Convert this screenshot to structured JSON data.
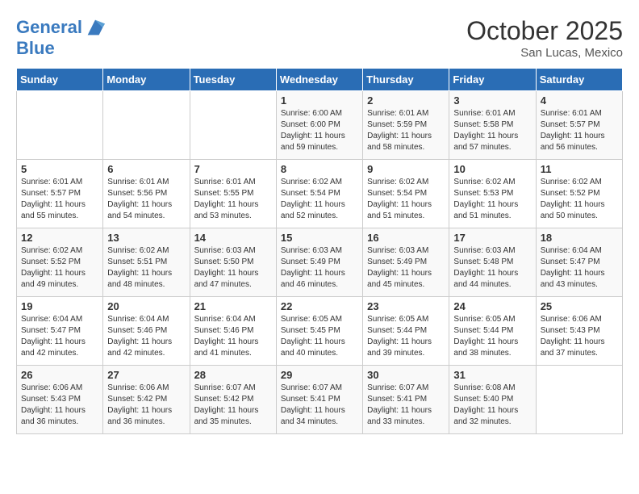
{
  "logo": {
    "line1": "General",
    "line2": "Blue"
  },
  "header": {
    "month": "October 2025",
    "location": "San Lucas, Mexico"
  },
  "days_of_week": [
    "Sunday",
    "Monday",
    "Tuesday",
    "Wednesday",
    "Thursday",
    "Friday",
    "Saturday"
  ],
  "weeks": [
    [
      {
        "day": "",
        "info": ""
      },
      {
        "day": "",
        "info": ""
      },
      {
        "day": "",
        "info": ""
      },
      {
        "day": "1",
        "info": "Sunrise: 6:00 AM\nSunset: 6:00 PM\nDaylight: 11 hours\nand 59 minutes."
      },
      {
        "day": "2",
        "info": "Sunrise: 6:01 AM\nSunset: 5:59 PM\nDaylight: 11 hours\nand 58 minutes."
      },
      {
        "day": "3",
        "info": "Sunrise: 6:01 AM\nSunset: 5:58 PM\nDaylight: 11 hours\nand 57 minutes."
      },
      {
        "day": "4",
        "info": "Sunrise: 6:01 AM\nSunset: 5:57 PM\nDaylight: 11 hours\nand 56 minutes."
      }
    ],
    [
      {
        "day": "5",
        "info": "Sunrise: 6:01 AM\nSunset: 5:57 PM\nDaylight: 11 hours\nand 55 minutes."
      },
      {
        "day": "6",
        "info": "Sunrise: 6:01 AM\nSunset: 5:56 PM\nDaylight: 11 hours\nand 54 minutes."
      },
      {
        "day": "7",
        "info": "Sunrise: 6:01 AM\nSunset: 5:55 PM\nDaylight: 11 hours\nand 53 minutes."
      },
      {
        "day": "8",
        "info": "Sunrise: 6:02 AM\nSunset: 5:54 PM\nDaylight: 11 hours\nand 52 minutes."
      },
      {
        "day": "9",
        "info": "Sunrise: 6:02 AM\nSunset: 5:54 PM\nDaylight: 11 hours\nand 51 minutes."
      },
      {
        "day": "10",
        "info": "Sunrise: 6:02 AM\nSunset: 5:53 PM\nDaylight: 11 hours\nand 51 minutes."
      },
      {
        "day": "11",
        "info": "Sunrise: 6:02 AM\nSunset: 5:52 PM\nDaylight: 11 hours\nand 50 minutes."
      }
    ],
    [
      {
        "day": "12",
        "info": "Sunrise: 6:02 AM\nSunset: 5:52 PM\nDaylight: 11 hours\nand 49 minutes."
      },
      {
        "day": "13",
        "info": "Sunrise: 6:02 AM\nSunset: 5:51 PM\nDaylight: 11 hours\nand 48 minutes."
      },
      {
        "day": "14",
        "info": "Sunrise: 6:03 AM\nSunset: 5:50 PM\nDaylight: 11 hours\nand 47 minutes."
      },
      {
        "day": "15",
        "info": "Sunrise: 6:03 AM\nSunset: 5:49 PM\nDaylight: 11 hours\nand 46 minutes."
      },
      {
        "day": "16",
        "info": "Sunrise: 6:03 AM\nSunset: 5:49 PM\nDaylight: 11 hours\nand 45 minutes."
      },
      {
        "day": "17",
        "info": "Sunrise: 6:03 AM\nSunset: 5:48 PM\nDaylight: 11 hours\nand 44 minutes."
      },
      {
        "day": "18",
        "info": "Sunrise: 6:04 AM\nSunset: 5:47 PM\nDaylight: 11 hours\nand 43 minutes."
      }
    ],
    [
      {
        "day": "19",
        "info": "Sunrise: 6:04 AM\nSunset: 5:47 PM\nDaylight: 11 hours\nand 42 minutes."
      },
      {
        "day": "20",
        "info": "Sunrise: 6:04 AM\nSunset: 5:46 PM\nDaylight: 11 hours\nand 42 minutes."
      },
      {
        "day": "21",
        "info": "Sunrise: 6:04 AM\nSunset: 5:46 PM\nDaylight: 11 hours\nand 41 minutes."
      },
      {
        "day": "22",
        "info": "Sunrise: 6:05 AM\nSunset: 5:45 PM\nDaylight: 11 hours\nand 40 minutes."
      },
      {
        "day": "23",
        "info": "Sunrise: 6:05 AM\nSunset: 5:44 PM\nDaylight: 11 hours\nand 39 minutes."
      },
      {
        "day": "24",
        "info": "Sunrise: 6:05 AM\nSunset: 5:44 PM\nDaylight: 11 hours\nand 38 minutes."
      },
      {
        "day": "25",
        "info": "Sunrise: 6:06 AM\nSunset: 5:43 PM\nDaylight: 11 hours\nand 37 minutes."
      }
    ],
    [
      {
        "day": "26",
        "info": "Sunrise: 6:06 AM\nSunset: 5:43 PM\nDaylight: 11 hours\nand 36 minutes."
      },
      {
        "day": "27",
        "info": "Sunrise: 6:06 AM\nSunset: 5:42 PM\nDaylight: 11 hours\nand 36 minutes."
      },
      {
        "day": "28",
        "info": "Sunrise: 6:07 AM\nSunset: 5:42 PM\nDaylight: 11 hours\nand 35 minutes."
      },
      {
        "day": "29",
        "info": "Sunrise: 6:07 AM\nSunset: 5:41 PM\nDaylight: 11 hours\nand 34 minutes."
      },
      {
        "day": "30",
        "info": "Sunrise: 6:07 AM\nSunset: 5:41 PM\nDaylight: 11 hours\nand 33 minutes."
      },
      {
        "day": "31",
        "info": "Sunrise: 6:08 AM\nSunset: 5:40 PM\nDaylight: 11 hours\nand 32 minutes."
      },
      {
        "day": "",
        "info": ""
      }
    ]
  ]
}
